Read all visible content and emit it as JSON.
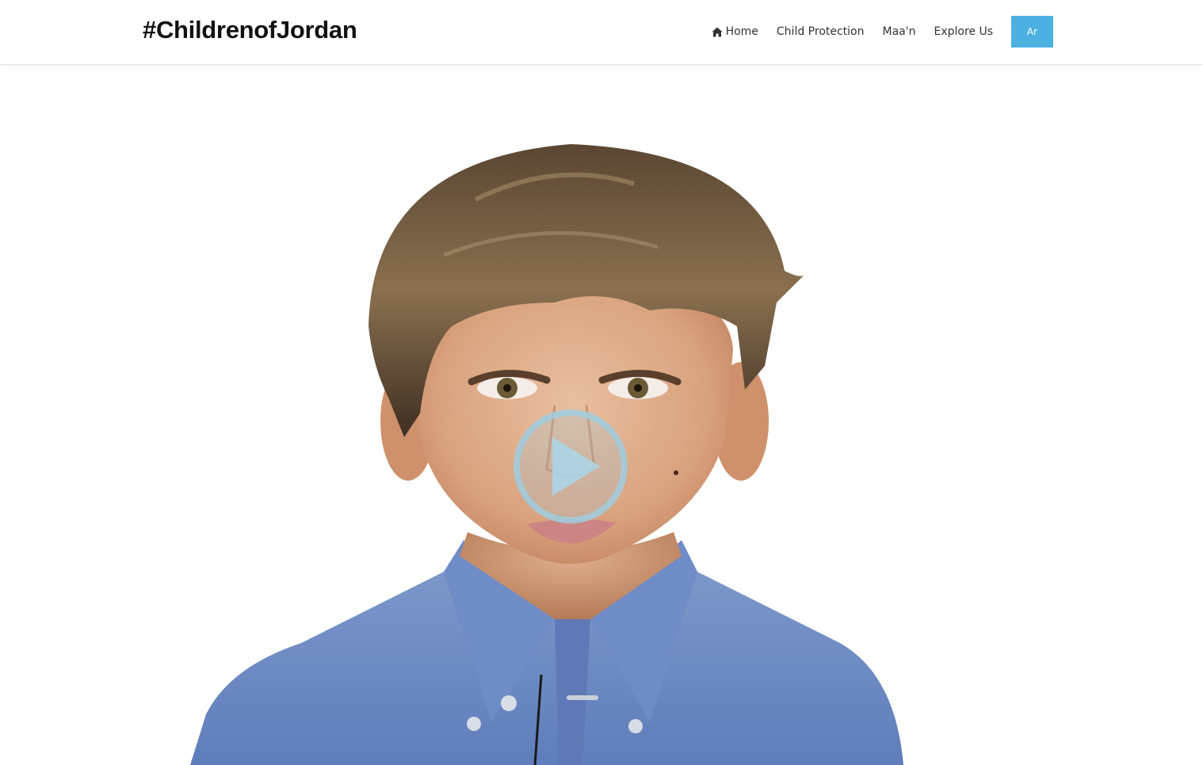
{
  "header": {
    "brand": "#ChildrenofJordan",
    "nav": [
      {
        "label": "Home",
        "icon": "home-icon"
      },
      {
        "label": "Child Protection"
      },
      {
        "label": "Maa'n"
      },
      {
        "label": "Explore Us"
      }
    ],
    "language_button": "Ar"
  },
  "hero": {
    "image": "boy-portrait",
    "play_icon": "play-icon"
  },
  "colors": {
    "accent": "#4cb1e1",
    "text": "#333333",
    "brand": "#111111"
  }
}
